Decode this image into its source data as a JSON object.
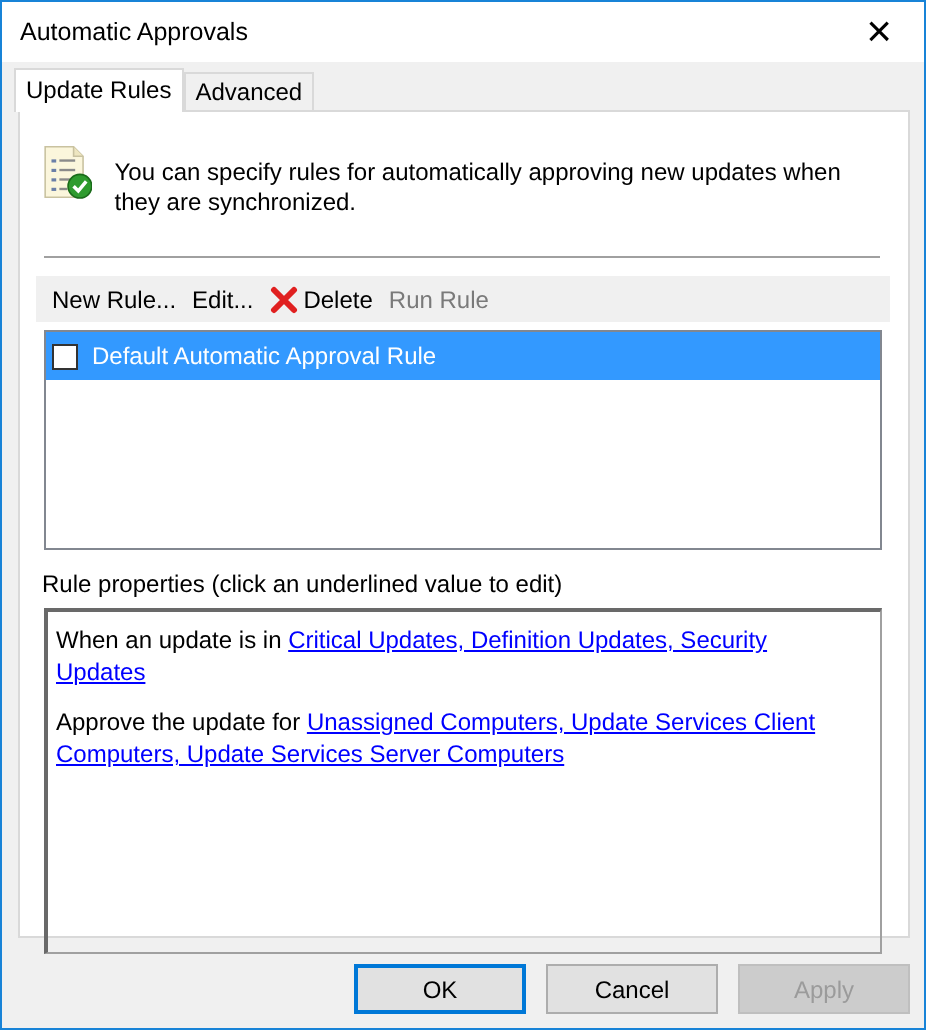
{
  "window": {
    "title": "Automatic Approvals",
    "close": "×"
  },
  "tabs": [
    {
      "label": "Update Rules",
      "selected": true
    },
    {
      "label": "Advanced",
      "selected": false
    }
  ],
  "intro": "You can specify rules for automatically approving new updates when they are synchronized.",
  "toolbar": [
    {
      "kind": "text",
      "label": "New Rule...",
      "disabled": false
    },
    {
      "kind": "text",
      "label": "Edit...",
      "disabled": false
    },
    {
      "kind": "delete",
      "label": "Delete",
      "disabled": false
    },
    {
      "kind": "text",
      "label": "Run Rule",
      "disabled": true
    }
  ],
  "rules": [
    {
      "label": "Default Automatic Approval Rule",
      "checked": false,
      "selected": true
    }
  ],
  "properties": {
    "label": "Rule properties (click an underlined value to edit)",
    "lines": [
      {
        "text": "When an update is in",
        "link_lines": [
          "Critical Updates, Definition Updates, Security",
          "Updates"
        ]
      },
      {
        "text": "Approve the update for",
        "link_lines": [
          "Unassigned Computers, Update Services Client",
          "Computers, Update Services Server Computers"
        ]
      }
    ]
  },
  "buttons": [
    {
      "label": "OK",
      "default": true,
      "disabled": false
    },
    {
      "label": "Cancel",
      "default": false,
      "disabled": false
    },
    {
      "label": "Apply",
      "default": false,
      "disabled": true
    }
  ]
}
